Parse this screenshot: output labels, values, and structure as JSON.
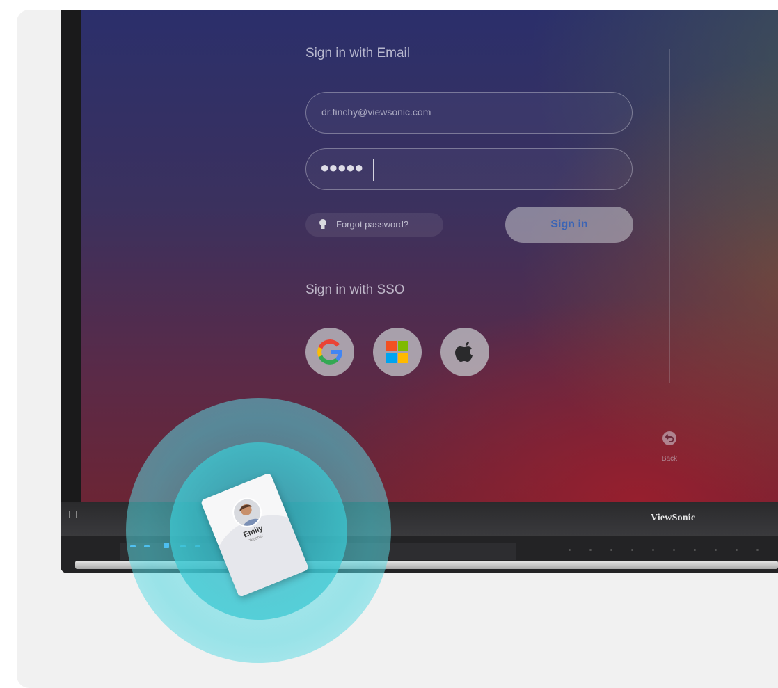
{
  "login": {
    "email_heading": "Sign in with Email",
    "email_value": "dr.finchy@viewsonic.com",
    "password_masked": "●●●●●",
    "forgot_label": "Forgot password?",
    "signin_label": "Sign in",
    "sso_heading": "Sign in with SSO",
    "sso_providers": [
      "google",
      "microsoft",
      "apple"
    ],
    "back_label": "Back"
  },
  "device": {
    "brand": "ViewSonic"
  },
  "nfc_card": {
    "name": "Emily",
    "subtitle": "Teacher"
  },
  "colors": {
    "signin_text": "#3b64b5",
    "nfc_pulse": "#50d7e1",
    "control_led": "#4aa3ff"
  }
}
